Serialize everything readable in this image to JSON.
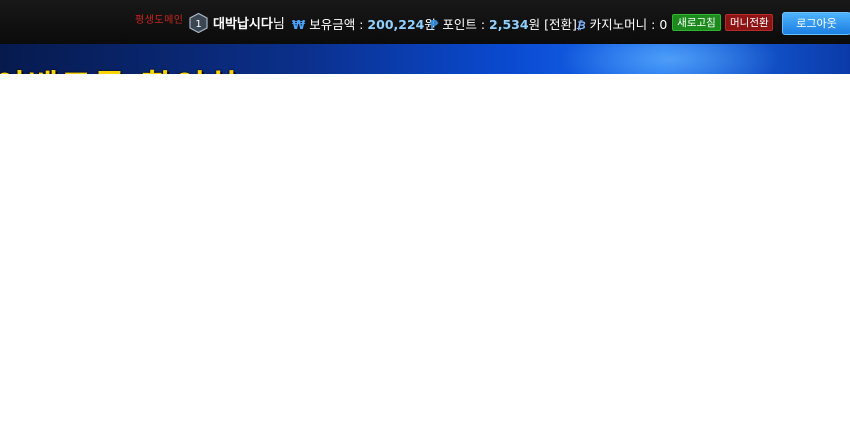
{
  "topbar": {
    "promo_text": "평생도메인",
    "level_number": "1",
    "username": "대박납시다",
    "username_suffix": "님",
    "balance_label": "보유금액 :",
    "balance_value": "200,224",
    "balance_unit": "원",
    "points_label": "포인트 :",
    "points_value": "2,534",
    "points_unit": "원",
    "points_exchange_label": "[전환]",
    "casino_label": "카지노머니 :",
    "casino_value": "0",
    "refresh_label": "새로고침",
    "money_convert_label": "머니전환",
    "logout_label": "로그아웃"
  },
  "icons": {
    "balance_icon": "₩",
    "points_icon": "₱",
    "casino_icon": "₿"
  },
  "banner": {
    "text": "이벤트를 확인하"
  },
  "colors": {
    "topbar_bg": "#111111",
    "value_highlight": "#8fd0ff",
    "refresh_button": "#1c8a1c",
    "money_button": "#8c1414",
    "logout_button": "#2a8cf0",
    "banner_text": "#ffd400"
  }
}
